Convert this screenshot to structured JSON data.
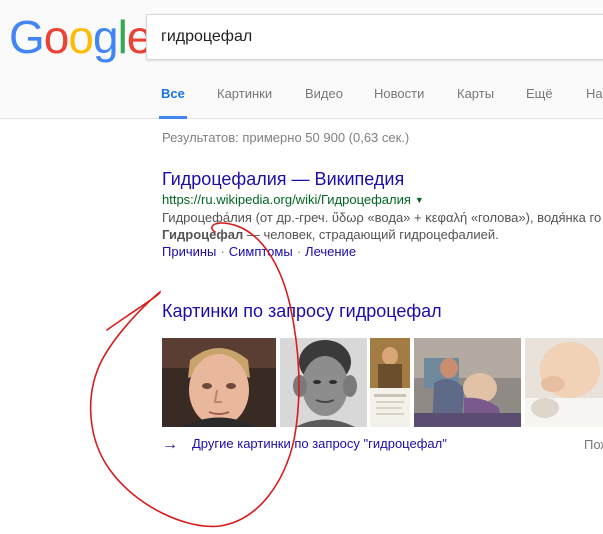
{
  "logo": {
    "text": "Google",
    "letters": [
      "G",
      "o",
      "o",
      "g",
      "l",
      "e"
    ],
    "colors": [
      "#4285F4",
      "#EA4335",
      "#FBBC05",
      "#4285F4",
      "#34A853",
      "#EA4335"
    ]
  },
  "search": {
    "value": "гидроцефал"
  },
  "tabs": [
    {
      "label": "Все",
      "active": true
    },
    {
      "label": "Картинки"
    },
    {
      "label": "Видео"
    },
    {
      "label": "Новости"
    },
    {
      "label": "Карты"
    },
    {
      "label": "Ещё"
    },
    {
      "label": "На"
    }
  ],
  "stats": "Результатов: примерно 50 900 (0,63 сек.)",
  "result": {
    "title": "Гидроцефалия — Википедия",
    "url": "https://ru.wikipedia.org/wiki/Гидроцефалия",
    "url_arrow": "▼",
    "snippet1": "Гидроцефа́лия (от др.-греч. ὕδωρ «вода» + κεφαλή «голова»), водя́нка го",
    "snippet2_bold": "Гидроцефал",
    "snippet2_rest": " — человек, страдающий гидроцефалией.",
    "sitelinks": [
      "Причины",
      "Симптомы",
      "Лечение"
    ],
    "sitelink_sep": "·"
  },
  "images": {
    "title": "Картинки по запросу гидроцефал",
    "more_arrow": "→",
    "more_label": "Другие картинки по запросу \"гидроцефал\"",
    "more_right": "Пож"
  },
  "annotation_color": "#d81c1c"
}
